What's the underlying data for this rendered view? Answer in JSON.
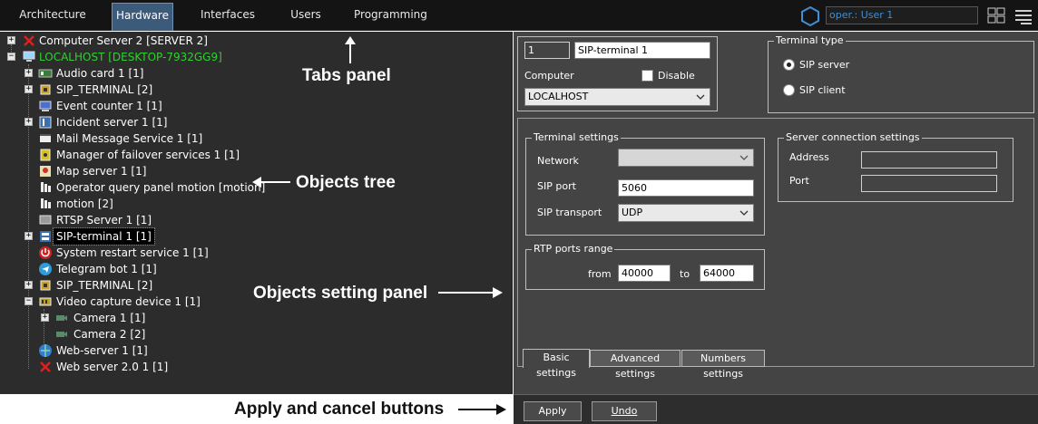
{
  "tabs": [
    {
      "label": "Architecture"
    },
    {
      "label": "Hardware"
    },
    {
      "label": "Interfaces"
    },
    {
      "label": "Users"
    },
    {
      "label": "Programming"
    }
  ],
  "user": {
    "value": "oper.: User 1"
  },
  "tree": [
    {
      "label": "Computer Server 2 [SERVER 2]",
      "icon": "red-cross-icon"
    },
    {
      "label": "LOCALHOST [DESKTOP-7932GG9]",
      "icon": "computer-icon"
    },
    {
      "label": "Audio card 1 [1]",
      "icon": "audio-card-icon"
    },
    {
      "label": "SIP_TERMINAL [2]",
      "icon": "chip-icon"
    },
    {
      "label": "Event counter 1 [1]",
      "icon": "monitor-icon"
    },
    {
      "label": "Incident server 1 [1]",
      "icon": "incident-server-icon"
    },
    {
      "label": "Mail Message Service 1 [1]",
      "icon": "mail-icon"
    },
    {
      "label": "Manager of failover services 1 [1]",
      "icon": "failover-icon"
    },
    {
      "label": "Map server 1 [1]",
      "icon": "map-icon"
    },
    {
      "label": "Operator query panel motion [motion]",
      "icon": "query-panel-icon"
    },
    {
      "label": "motion [2]",
      "icon": "motion-icon"
    },
    {
      "label": "RTSP Server 1 [1]",
      "icon": "rtsp-icon"
    },
    {
      "label": "SIP-terminal 1 [1]",
      "icon": "sip-terminal-icon"
    },
    {
      "label": "System restart service 1 [1]",
      "icon": "power-icon"
    },
    {
      "label": "Telegram bot 1 [1]",
      "icon": "telegram-icon"
    },
    {
      "label": "SIP_TERMINAL [2]",
      "icon": "chip-icon"
    },
    {
      "label": "Video capture device 1 [1]",
      "icon": "capture-card-icon"
    },
    {
      "label": "Camera 1 [1]",
      "icon": "camera-icon"
    },
    {
      "label": "Camera 2 [2]",
      "icon": "camera-icon"
    },
    {
      "label": "Web-server 1 [1]",
      "icon": "globe-icon"
    },
    {
      "label": "Web server 2.0 1 [1]",
      "icon": "red-cross-icon"
    }
  ],
  "object": {
    "id": "1",
    "name": "SIP-terminal 1"
  },
  "computer": {
    "label": "Computer",
    "value": "LOCALHOST",
    "disable_label": "Disable"
  },
  "terminal_type": {
    "title": "Terminal type",
    "options": [
      "SIP server",
      "SIP client"
    ]
  },
  "terminal_settings": {
    "title": "Terminal settings",
    "network_label": "Network",
    "network_value": "",
    "sip_port_label": "SIP port",
    "sip_port_value": "5060",
    "sip_transport_label": "SIP transport",
    "sip_transport_value": "UDP"
  },
  "server_connection": {
    "title": "Server connection settings",
    "address_label": "Address",
    "port_label": "Port"
  },
  "rtp": {
    "title": "RTP ports range",
    "from_label": "from",
    "from_value": "40000",
    "to_label": "to",
    "to_value": "64000"
  },
  "subtabs": [
    "Basic settings",
    "Advanced settings",
    "Numbers settings"
  ],
  "buttons": {
    "apply": "Apply",
    "undo": "Undo"
  },
  "annotations": {
    "tabs_panel": "Tabs panel",
    "objects_tree": "Objects tree",
    "objects_setting_panel": "Objects setting panel",
    "apply_cancel": "Apply and cancel buttons"
  },
  "colors": {
    "active_tab": "#3c5a7a",
    "tree_bg": "#2c2c2c",
    "panel_bg": "#444444",
    "localhost_green": "#2fd12f",
    "user_text": "#3f8fd6"
  }
}
